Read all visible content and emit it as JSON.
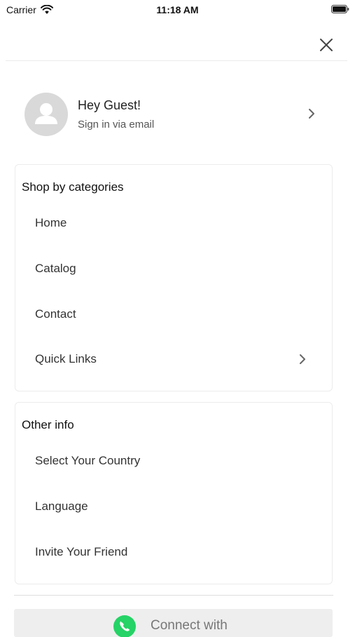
{
  "status_bar": {
    "carrier": "Carrier",
    "time": "11:18 AM"
  },
  "profile": {
    "greeting": "Hey Guest!",
    "subtitle": "Sign in via email"
  },
  "categories": {
    "title": "Shop by categories",
    "items": [
      {
        "label": "Home"
      },
      {
        "label": "Catalog"
      },
      {
        "label": "Contact"
      },
      {
        "label": "Quick Links"
      }
    ]
  },
  "other_info": {
    "title": "Other info",
    "items": [
      {
        "label": "Select Your Country"
      },
      {
        "label": "Language"
      },
      {
        "label": "Invite Your Friend"
      }
    ]
  },
  "connect": {
    "label": "Connect with",
    "icon": "whatsapp-icon",
    "icon_color": "#25D366"
  },
  "colors": {
    "avatar_bg": "#d9d9d9",
    "divider": "#ececec",
    "button_bg": "#eeeeee"
  }
}
